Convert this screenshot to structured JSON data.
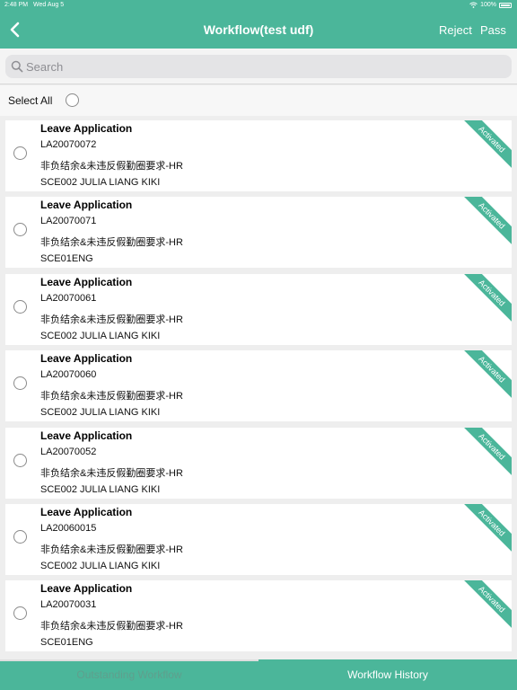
{
  "status_bar": {
    "time": "2:48 PM",
    "date": "Wed Aug 5",
    "battery": "100%"
  },
  "nav": {
    "title": "Workflow(test udf)",
    "reject_label": "Reject",
    "pass_label": "Pass"
  },
  "search": {
    "placeholder": "Search"
  },
  "select_all": {
    "label": "Select All"
  },
  "items": [
    {
      "title": "Leave Application",
      "code": "LA20070072",
      "desc": "非负结余&未违反假勤圈要求-HR",
      "user": "SCE002 JULIA LIANG KIKI",
      "status": "Activated"
    },
    {
      "title": "Leave Application",
      "code": "LA20070071",
      "desc": "非负结余&未违反假勤圈要求-HR",
      "user": "SCE01ENG",
      "status": "Activated"
    },
    {
      "title": "Leave Application",
      "code": "LA20070061",
      "desc": "非负结余&未违反假勤圈要求-HR",
      "user": "SCE002 JULIA LIANG KIKI",
      "status": "Activated"
    },
    {
      "title": "Leave Application",
      "code": "LA20070060",
      "desc": "非负结余&未违反假勤圈要求-HR",
      "user": "SCE002 JULIA LIANG KIKI",
      "status": "Activated"
    },
    {
      "title": "Leave Application",
      "code": "LA20070052",
      "desc": "非负结余&未违反假勤圈要求-HR",
      "user": "SCE002 JULIA LIANG KIKI",
      "status": "Activated"
    },
    {
      "title": "Leave Application",
      "code": "LA20060015",
      "desc": "非负结余&未违反假勤圈要求-HR",
      "user": "SCE002 JULIA LIANG KIKI",
      "status": "Activated"
    },
    {
      "title": "Leave Application",
      "code": "LA20070031",
      "desc": "非负结余&未违反假勤圈要求-HR",
      "user": "SCE01ENG",
      "status": "Activated"
    }
  ],
  "tabs": {
    "outstanding": "Outstanding Workflow",
    "history": "Workflow History"
  },
  "colors": {
    "accent": "#4bb69a",
    "inactive_tab_text": "#5f9f8d"
  }
}
